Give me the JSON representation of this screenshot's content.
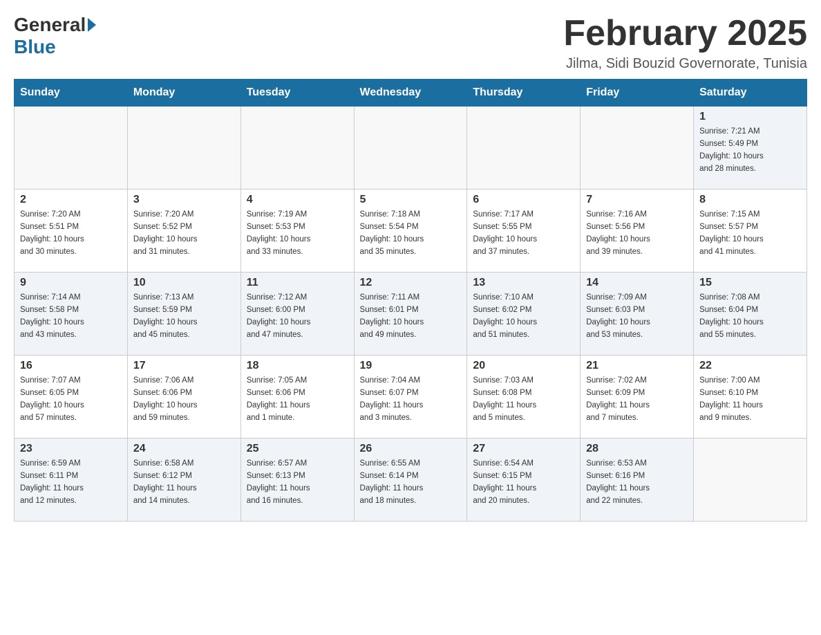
{
  "header": {
    "logo_general": "General",
    "logo_blue": "Blue",
    "title": "February 2025",
    "subtitle": "Jilma, Sidi Bouzid Governorate, Tunisia"
  },
  "days_of_week": [
    "Sunday",
    "Monday",
    "Tuesday",
    "Wednesday",
    "Thursday",
    "Friday",
    "Saturday"
  ],
  "weeks": [
    {
      "days": [
        {
          "num": "",
          "info": ""
        },
        {
          "num": "",
          "info": ""
        },
        {
          "num": "",
          "info": ""
        },
        {
          "num": "",
          "info": ""
        },
        {
          "num": "",
          "info": ""
        },
        {
          "num": "",
          "info": ""
        },
        {
          "num": "1",
          "info": "Sunrise: 7:21 AM\nSunset: 5:49 PM\nDaylight: 10 hours\nand 28 minutes."
        }
      ]
    },
    {
      "days": [
        {
          "num": "2",
          "info": "Sunrise: 7:20 AM\nSunset: 5:51 PM\nDaylight: 10 hours\nand 30 minutes."
        },
        {
          "num": "3",
          "info": "Sunrise: 7:20 AM\nSunset: 5:52 PM\nDaylight: 10 hours\nand 31 minutes."
        },
        {
          "num": "4",
          "info": "Sunrise: 7:19 AM\nSunset: 5:53 PM\nDaylight: 10 hours\nand 33 minutes."
        },
        {
          "num": "5",
          "info": "Sunrise: 7:18 AM\nSunset: 5:54 PM\nDaylight: 10 hours\nand 35 minutes."
        },
        {
          "num": "6",
          "info": "Sunrise: 7:17 AM\nSunset: 5:55 PM\nDaylight: 10 hours\nand 37 minutes."
        },
        {
          "num": "7",
          "info": "Sunrise: 7:16 AM\nSunset: 5:56 PM\nDaylight: 10 hours\nand 39 minutes."
        },
        {
          "num": "8",
          "info": "Sunrise: 7:15 AM\nSunset: 5:57 PM\nDaylight: 10 hours\nand 41 minutes."
        }
      ]
    },
    {
      "days": [
        {
          "num": "9",
          "info": "Sunrise: 7:14 AM\nSunset: 5:58 PM\nDaylight: 10 hours\nand 43 minutes."
        },
        {
          "num": "10",
          "info": "Sunrise: 7:13 AM\nSunset: 5:59 PM\nDaylight: 10 hours\nand 45 minutes."
        },
        {
          "num": "11",
          "info": "Sunrise: 7:12 AM\nSunset: 6:00 PM\nDaylight: 10 hours\nand 47 minutes."
        },
        {
          "num": "12",
          "info": "Sunrise: 7:11 AM\nSunset: 6:01 PM\nDaylight: 10 hours\nand 49 minutes."
        },
        {
          "num": "13",
          "info": "Sunrise: 7:10 AM\nSunset: 6:02 PM\nDaylight: 10 hours\nand 51 minutes."
        },
        {
          "num": "14",
          "info": "Sunrise: 7:09 AM\nSunset: 6:03 PM\nDaylight: 10 hours\nand 53 minutes."
        },
        {
          "num": "15",
          "info": "Sunrise: 7:08 AM\nSunset: 6:04 PM\nDaylight: 10 hours\nand 55 minutes."
        }
      ]
    },
    {
      "days": [
        {
          "num": "16",
          "info": "Sunrise: 7:07 AM\nSunset: 6:05 PM\nDaylight: 10 hours\nand 57 minutes."
        },
        {
          "num": "17",
          "info": "Sunrise: 7:06 AM\nSunset: 6:06 PM\nDaylight: 10 hours\nand 59 minutes."
        },
        {
          "num": "18",
          "info": "Sunrise: 7:05 AM\nSunset: 6:06 PM\nDaylight: 11 hours\nand 1 minute."
        },
        {
          "num": "19",
          "info": "Sunrise: 7:04 AM\nSunset: 6:07 PM\nDaylight: 11 hours\nand 3 minutes."
        },
        {
          "num": "20",
          "info": "Sunrise: 7:03 AM\nSunset: 6:08 PM\nDaylight: 11 hours\nand 5 minutes."
        },
        {
          "num": "21",
          "info": "Sunrise: 7:02 AM\nSunset: 6:09 PM\nDaylight: 11 hours\nand 7 minutes."
        },
        {
          "num": "22",
          "info": "Sunrise: 7:00 AM\nSunset: 6:10 PM\nDaylight: 11 hours\nand 9 minutes."
        }
      ]
    },
    {
      "days": [
        {
          "num": "23",
          "info": "Sunrise: 6:59 AM\nSunset: 6:11 PM\nDaylight: 11 hours\nand 12 minutes."
        },
        {
          "num": "24",
          "info": "Sunrise: 6:58 AM\nSunset: 6:12 PM\nDaylight: 11 hours\nand 14 minutes."
        },
        {
          "num": "25",
          "info": "Sunrise: 6:57 AM\nSunset: 6:13 PM\nDaylight: 11 hours\nand 16 minutes."
        },
        {
          "num": "26",
          "info": "Sunrise: 6:55 AM\nSunset: 6:14 PM\nDaylight: 11 hours\nand 18 minutes."
        },
        {
          "num": "27",
          "info": "Sunrise: 6:54 AM\nSunset: 6:15 PM\nDaylight: 11 hours\nand 20 minutes."
        },
        {
          "num": "28",
          "info": "Sunrise: 6:53 AM\nSunset: 6:16 PM\nDaylight: 11 hours\nand 22 minutes."
        },
        {
          "num": "",
          "info": ""
        }
      ]
    }
  ]
}
